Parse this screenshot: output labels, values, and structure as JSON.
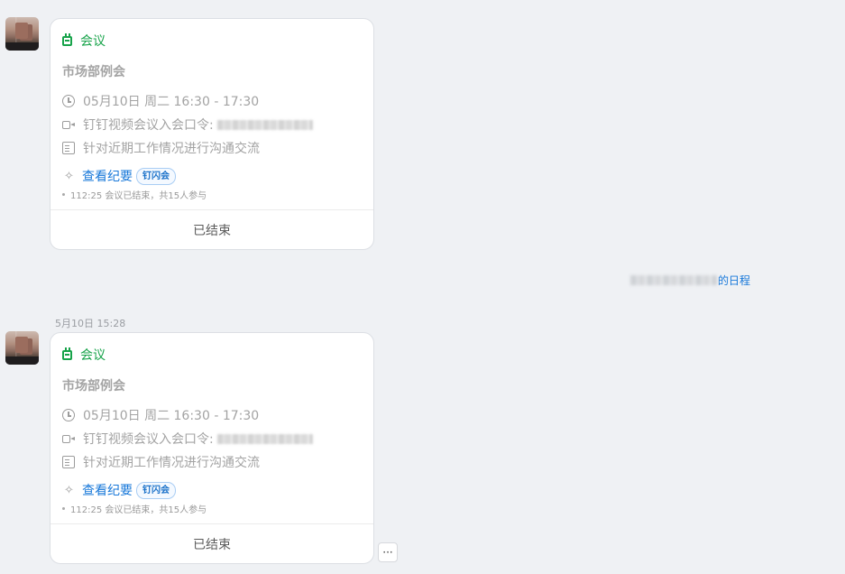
{
  "messages": [
    {
      "card": {
        "type_label": "会议",
        "title": "市场部例会",
        "time": "05月10日 周二 16:30 - 17:30",
        "video_label": "钉钉视频会议入会口令:",
        "description": "针对近期工作情况进行沟通交流",
        "summary_link": "查看纪要",
        "summary_tag": "钉闪会",
        "stats": "112:25 会议已结束，共15人参与",
        "status": "已结束"
      }
    },
    {
      "timestamp": "5月10日 15:28",
      "card": {
        "type_label": "会议",
        "title": "市场部例会",
        "time": "05月10日 周二 16:30 - 17:30",
        "video_label": "钉钉视频会议入会口令:",
        "description": "针对近期工作情况进行沟通交流",
        "summary_link": "查看纪要",
        "summary_tag": "钉闪会",
        "stats": "112:25 会议已结束，共15人参与",
        "status": "已结束"
      }
    }
  ],
  "system_notice": {
    "link_text": "的日程"
  },
  "more_button": {
    "label": "···"
  },
  "colors": {
    "accent_green": "#17a34a",
    "link_blue": "#1677d9",
    "background": "#eff1f4"
  }
}
